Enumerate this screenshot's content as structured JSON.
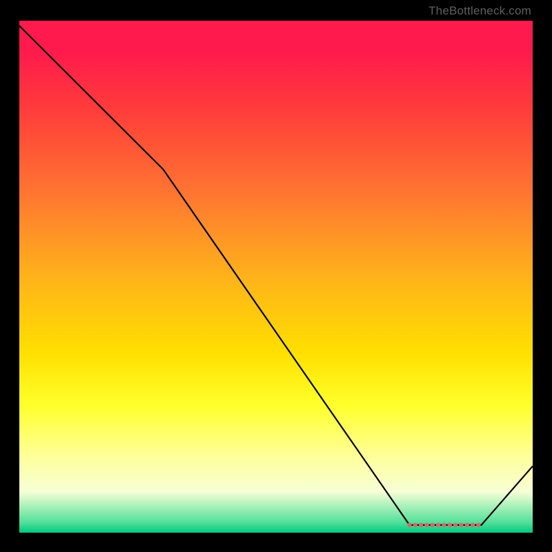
{
  "chart_data": {
    "type": "line",
    "x": [
      0,
      28,
      76,
      82,
      90,
      100
    ],
    "values": [
      99,
      71,
      1.5,
      1.5,
      1.5,
      13
    ],
    "title": "",
    "xlabel": "",
    "ylabel": "",
    "ylim": [
      0,
      100
    ],
    "marker_segment": {
      "x_from": 76,
      "x_to": 90,
      "y": 1.5
    }
  },
  "attribution": "TheBottleneck.com"
}
